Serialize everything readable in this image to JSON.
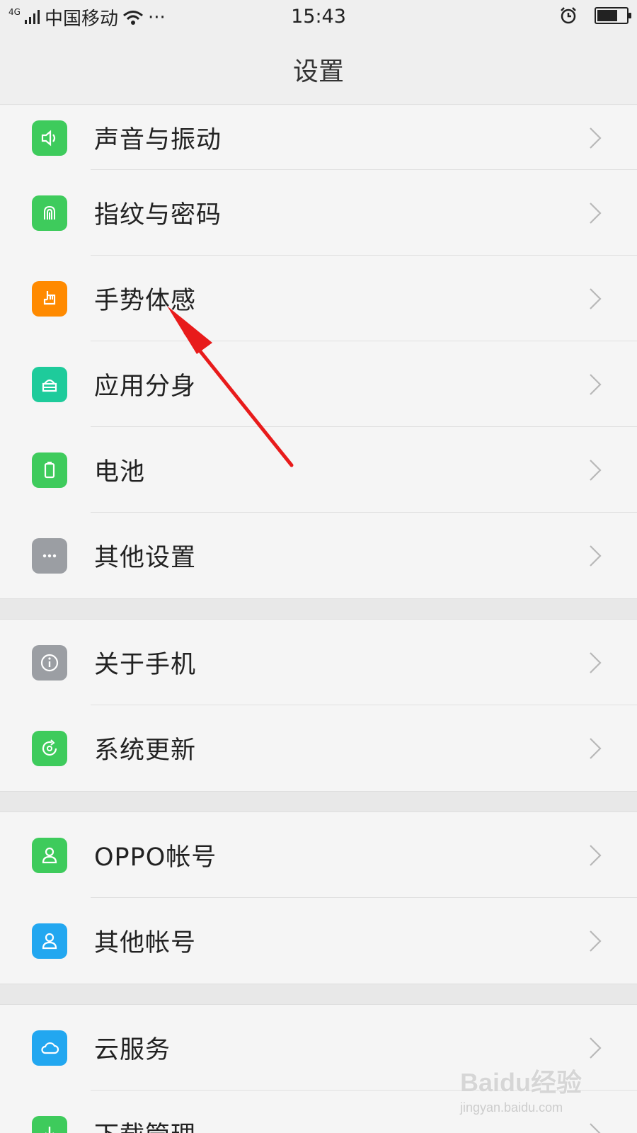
{
  "status_bar": {
    "network": "4G",
    "carrier": "中国移动",
    "more": "···",
    "time": "15:43",
    "battery_level": 0.7,
    "icons": [
      "signal-icon",
      "wifi-icon",
      "alarm-icon",
      "battery-icon"
    ]
  },
  "header": {
    "title": "设置"
  },
  "groups": [
    {
      "items": [
        {
          "label": "声音与振动",
          "icon": "speaker-icon",
          "color": "#3ecb5c"
        },
        {
          "label": "指纹与密码",
          "icon": "fingerprint-icon",
          "color": "#3ecb5c"
        },
        {
          "label": "手势体感",
          "icon": "gesture-icon",
          "color": "#ff8a00"
        },
        {
          "label": "应用分身",
          "icon": "clone-app-icon",
          "color": "#1ecb9b"
        },
        {
          "label": "电池",
          "icon": "battery-icon",
          "color": "#3ecb5c"
        },
        {
          "label": "其他设置",
          "icon": "more-icon",
          "color": "#9b9ea3"
        }
      ]
    },
    {
      "items": [
        {
          "label": "关于手机",
          "icon": "info-icon",
          "color": "#9b9ea3"
        },
        {
          "label": "系统更新",
          "icon": "update-icon",
          "color": "#3ecb5c"
        }
      ]
    },
    {
      "items": [
        {
          "label": "OPPO帐号",
          "icon": "user-icon",
          "color": "#3ecb5c"
        },
        {
          "label": "其他帐号",
          "icon": "user-icon",
          "color": "#22a7f0"
        }
      ]
    },
    {
      "items": [
        {
          "label": "云服务",
          "icon": "cloud-icon",
          "color": "#22a7f0"
        },
        {
          "label": "下载管理",
          "icon": "download-icon",
          "color": "#3ecb5c"
        }
      ]
    }
  ],
  "annotation": {
    "arrow_color": "#e81b1b"
  },
  "watermark": {
    "main": "Baidu经验",
    "sub": "jingyan.baidu.com"
  }
}
